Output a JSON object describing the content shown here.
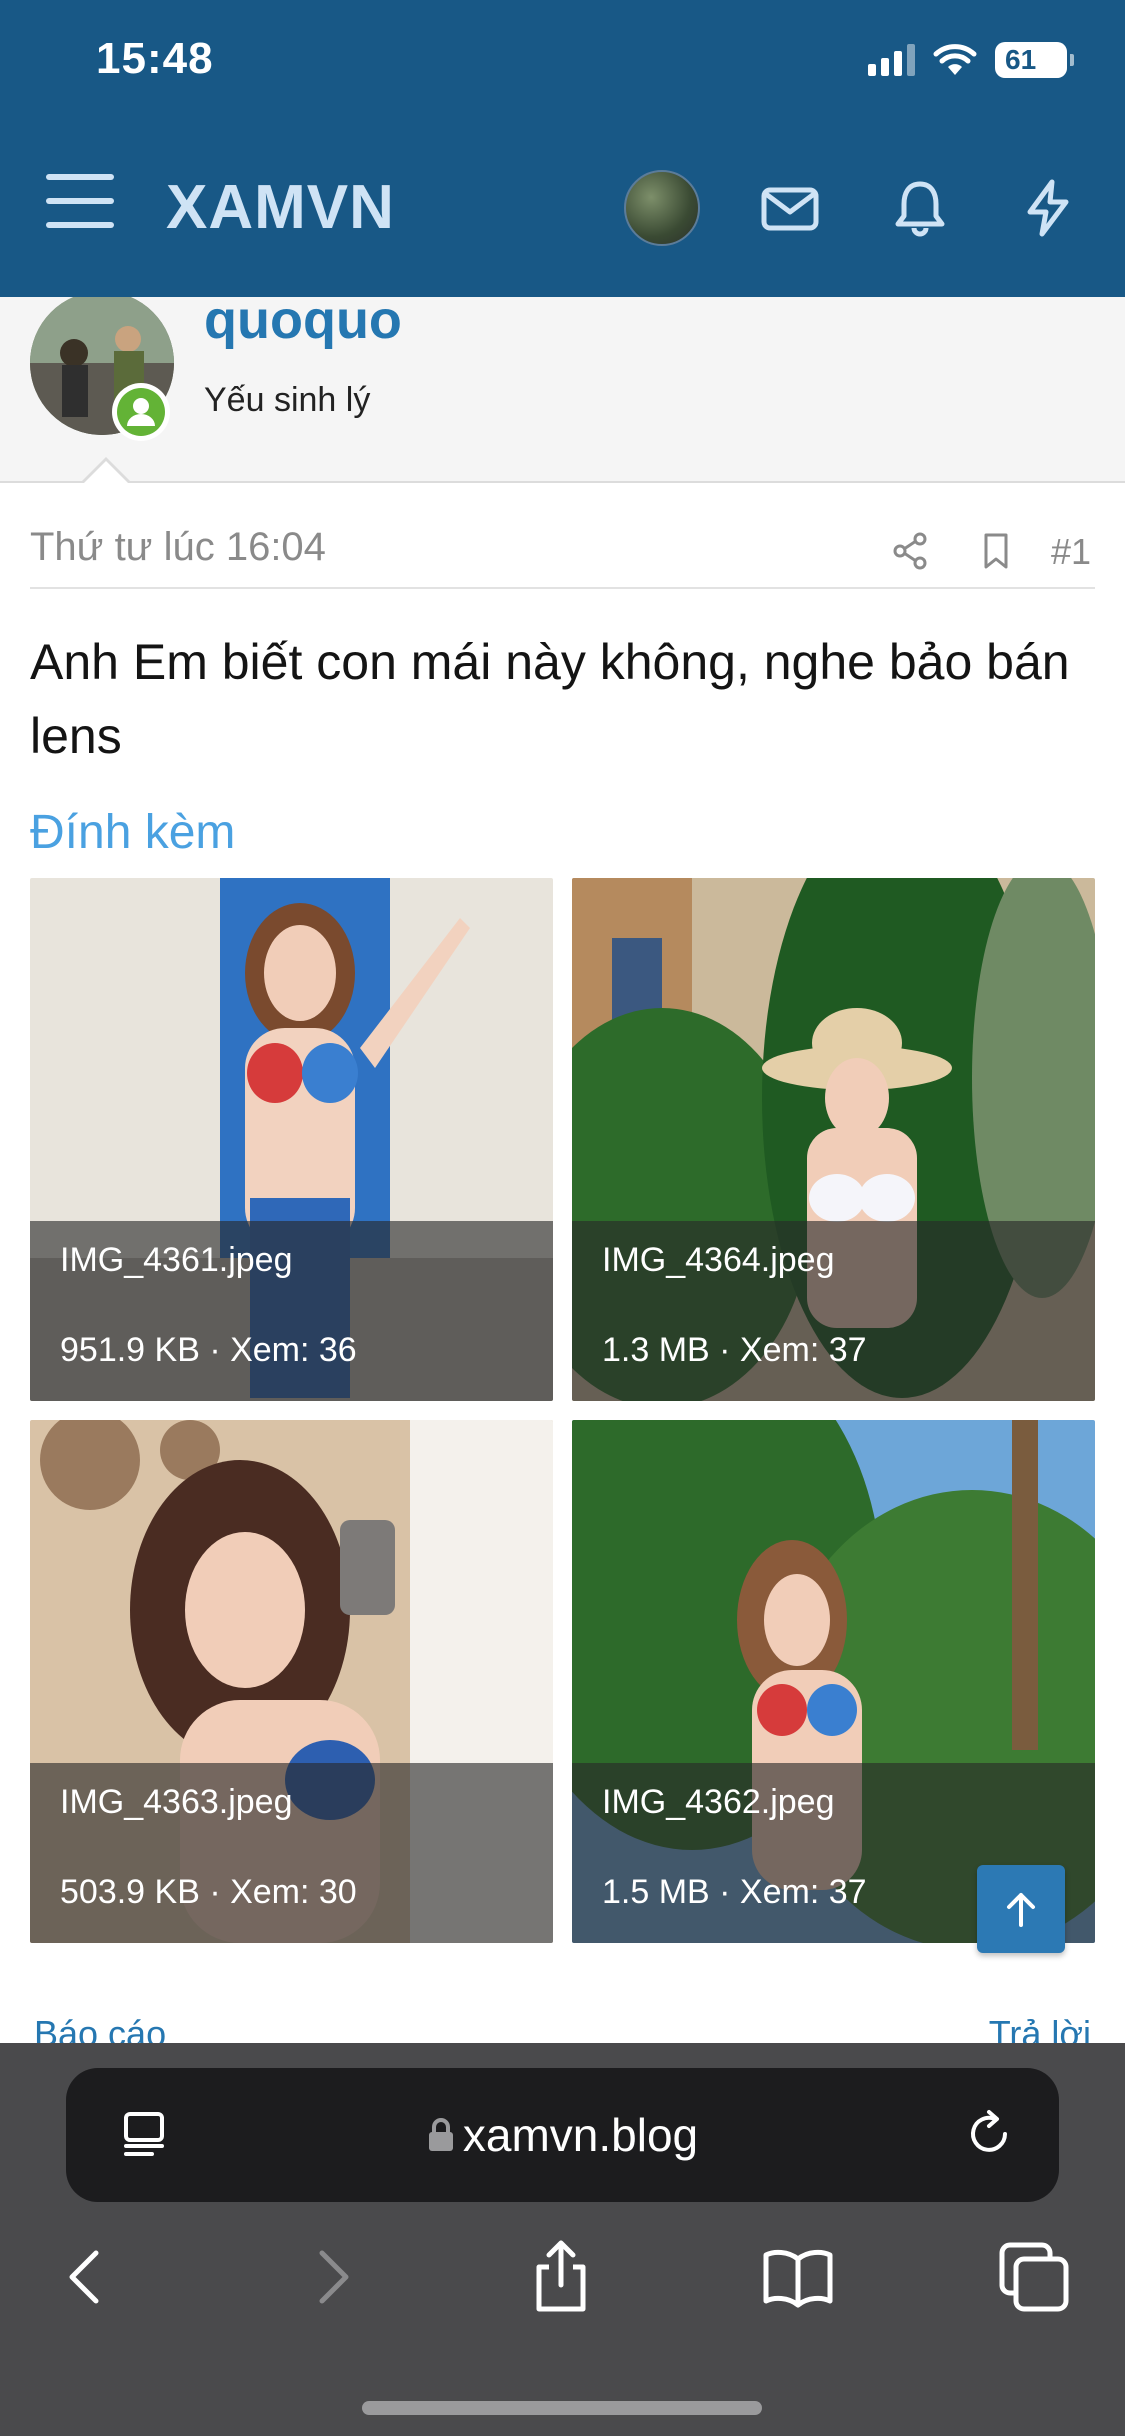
{
  "status_bar": {
    "time": "15:48",
    "battery": "61"
  },
  "header": {
    "brand": "XAMVN"
  },
  "member": {
    "name": "quoquo",
    "title": "Yếu sinh lý"
  },
  "post": {
    "date": "Thứ tư lúc 16:04",
    "number": "#1",
    "body": "Anh Em biết con mái này không, nghe bảo bán lens",
    "attachments_label": "Đính kèm",
    "attachments": [
      {
        "name": "IMG_4361.jpeg",
        "meta": "951.9 KB · Xem: 36"
      },
      {
        "name": "IMG_4364.jpeg",
        "meta": "1.3 MB · Xem: 37"
      },
      {
        "name": "IMG_4363.jpeg",
        "meta": "503.9 KB · Xem: 30"
      },
      {
        "name": "IMG_4362.jpeg",
        "meta": "1.5 MB · Xem: 37"
      }
    ],
    "report_label": "Báo cáo",
    "reply_label": "Trả lời"
  },
  "browser": {
    "url": "xamvn.blog"
  },
  "colors": {
    "header": "#185886",
    "link": "#2577b1",
    "accent": "#4aa1e1",
    "online": "#63b336"
  }
}
